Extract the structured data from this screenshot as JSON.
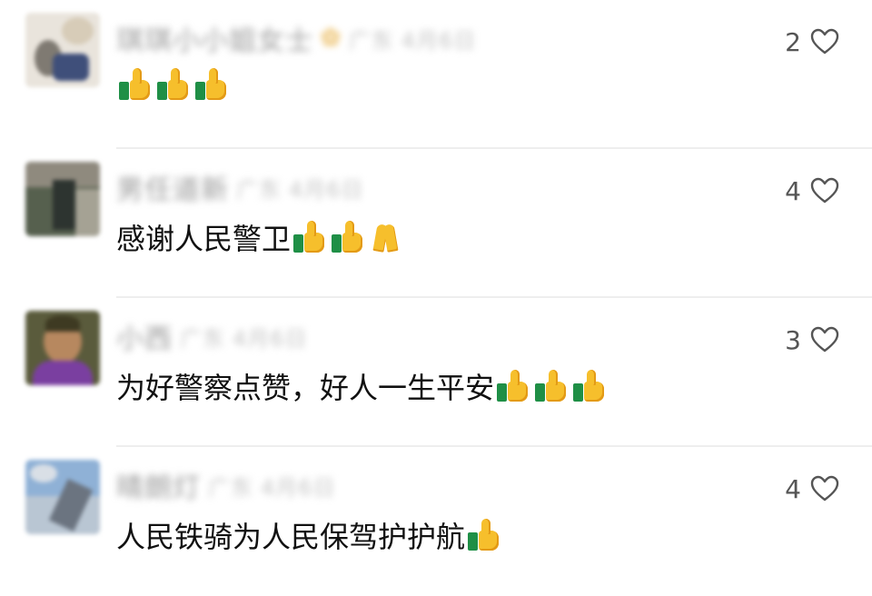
{
  "comments": [
    {
      "username": "琪琪小小姐女士",
      "location": "广东",
      "time": "4月6日",
      "text": "",
      "emojis": [
        "thumbs-up",
        "thumbs-up",
        "thumbs-up"
      ],
      "likes": "2",
      "avatar_colors": [
        "#e9e4dc",
        "#7f7a72",
        "#3f4f7a",
        "#d7ccb8"
      ]
    },
    {
      "username": "男任道新",
      "location": "广东",
      "time": "4月6日",
      "text": "感谢人民警卫",
      "emojis": [
        "thumbs-up",
        "thumbs-up",
        "folded-hands"
      ],
      "likes": "4",
      "avatar_colors": [
        "#56604e",
        "#2d3430",
        "#8f8a7e",
        "#a5a294"
      ]
    },
    {
      "username": "小西",
      "location": "广东",
      "time": "4月6日",
      "text": "为好警察点赞，好人一生平安",
      "emojis": [
        "thumbs-up",
        "thumbs-up",
        "thumbs-up"
      ],
      "likes": "3",
      "avatar_colors": [
        "#5a5b3c",
        "#b7885f",
        "#7a3fa0",
        "#3e3a22"
      ]
    },
    {
      "username": "晴朗灯",
      "location": "广东",
      "time": "4月6日",
      "text": "人民铁骑为人民保驾护护航",
      "emojis": [
        "thumbs-up"
      ],
      "likes": "4",
      "avatar_colors": [
        "#8fb1d6",
        "#d9dfe6",
        "#6b7480",
        "#b9c6d3"
      ]
    }
  ],
  "icons": {
    "like": "heart-outline-icon"
  },
  "colors": {
    "text": "#111111",
    "meta": "#9a9a9a",
    "like_count": "#555555",
    "divider": "#eeeeee"
  }
}
